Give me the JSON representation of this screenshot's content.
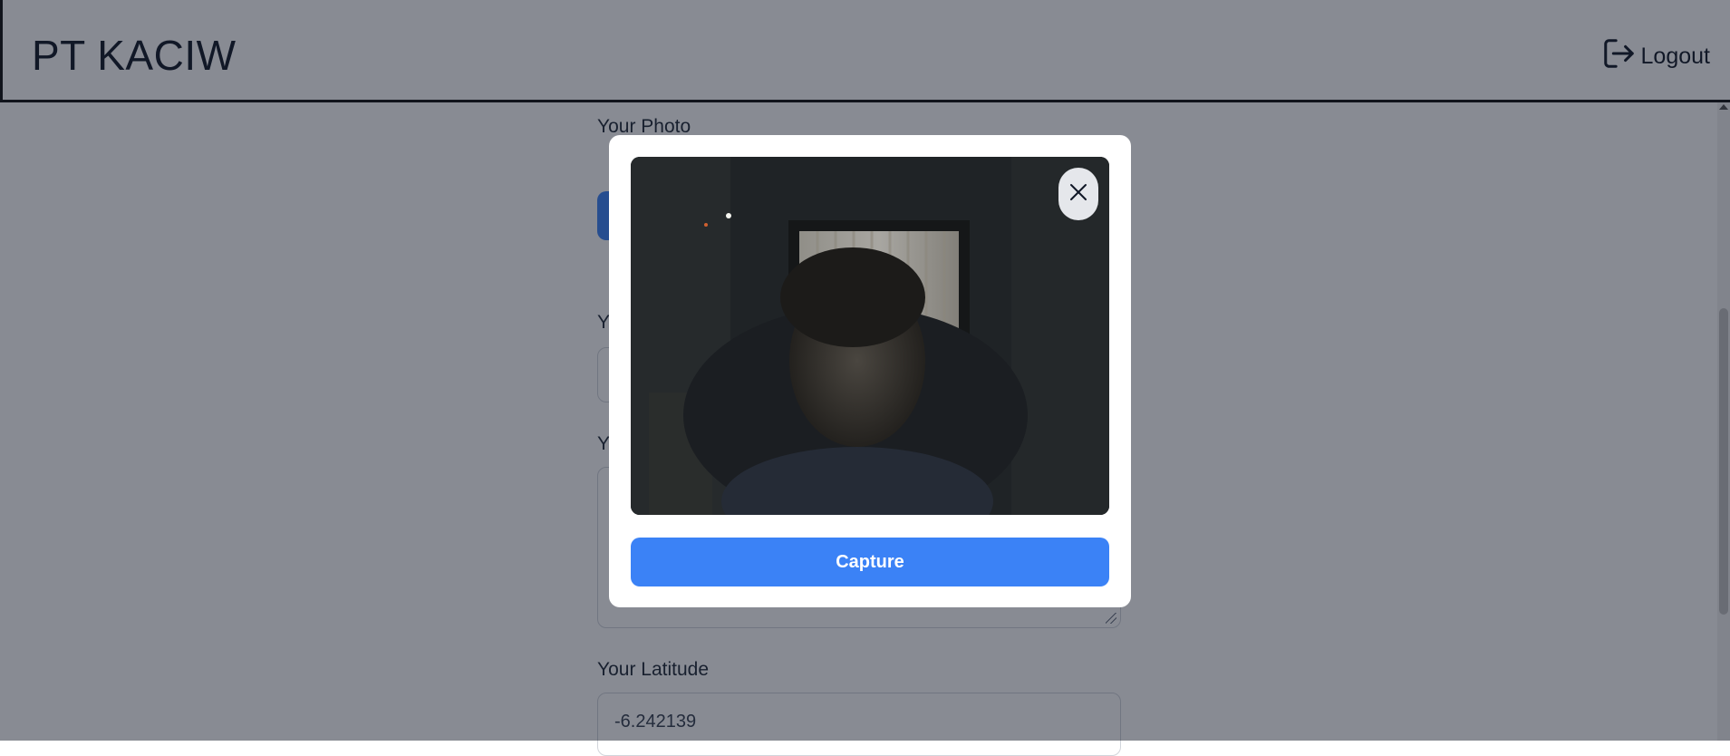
{
  "header": {
    "brand": "PT KACIW",
    "logout_label": "Logout",
    "logout_icon": "logout-icon"
  },
  "form": {
    "photo_label": "Your Photo",
    "name_label_partial": "Yo",
    "address_label_partial": "Yo",
    "latitude_label": "Your Latitude",
    "latitude_value": "-6.242139"
  },
  "modal": {
    "close_icon": "close-icon",
    "capture_label": "Capture"
  },
  "colors": {
    "accent": "#3b82f6",
    "overlay": "rgba(17,24,39,0.5)"
  }
}
